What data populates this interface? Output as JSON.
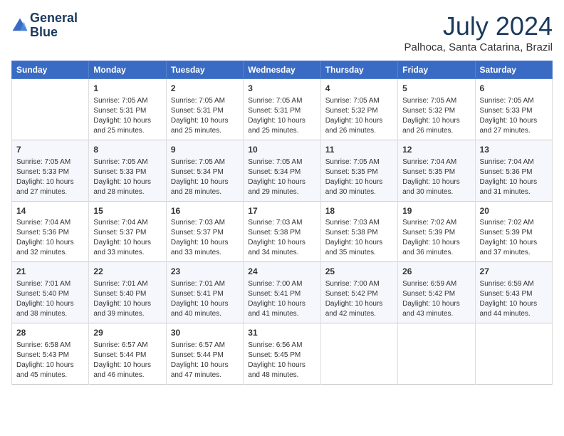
{
  "header": {
    "logo_line1": "General",
    "logo_line2": "Blue",
    "month": "July 2024",
    "location": "Palhoca, Santa Catarina, Brazil"
  },
  "weekdays": [
    "Sunday",
    "Monday",
    "Tuesday",
    "Wednesday",
    "Thursday",
    "Friday",
    "Saturday"
  ],
  "weeks": [
    [
      {
        "day": "",
        "content": ""
      },
      {
        "day": "1",
        "content": "Sunrise: 7:05 AM\nSunset: 5:31 PM\nDaylight: 10 hours\nand 25 minutes."
      },
      {
        "day": "2",
        "content": "Sunrise: 7:05 AM\nSunset: 5:31 PM\nDaylight: 10 hours\nand 25 minutes."
      },
      {
        "day": "3",
        "content": "Sunrise: 7:05 AM\nSunset: 5:31 PM\nDaylight: 10 hours\nand 25 minutes."
      },
      {
        "day": "4",
        "content": "Sunrise: 7:05 AM\nSunset: 5:32 PM\nDaylight: 10 hours\nand 26 minutes."
      },
      {
        "day": "5",
        "content": "Sunrise: 7:05 AM\nSunset: 5:32 PM\nDaylight: 10 hours\nand 26 minutes."
      },
      {
        "day": "6",
        "content": "Sunrise: 7:05 AM\nSunset: 5:33 PM\nDaylight: 10 hours\nand 27 minutes."
      }
    ],
    [
      {
        "day": "7",
        "content": "Sunrise: 7:05 AM\nSunset: 5:33 PM\nDaylight: 10 hours\nand 27 minutes."
      },
      {
        "day": "8",
        "content": "Sunrise: 7:05 AM\nSunset: 5:33 PM\nDaylight: 10 hours\nand 28 minutes."
      },
      {
        "day": "9",
        "content": "Sunrise: 7:05 AM\nSunset: 5:34 PM\nDaylight: 10 hours\nand 28 minutes."
      },
      {
        "day": "10",
        "content": "Sunrise: 7:05 AM\nSunset: 5:34 PM\nDaylight: 10 hours\nand 29 minutes."
      },
      {
        "day": "11",
        "content": "Sunrise: 7:05 AM\nSunset: 5:35 PM\nDaylight: 10 hours\nand 30 minutes."
      },
      {
        "day": "12",
        "content": "Sunrise: 7:04 AM\nSunset: 5:35 PM\nDaylight: 10 hours\nand 30 minutes."
      },
      {
        "day": "13",
        "content": "Sunrise: 7:04 AM\nSunset: 5:36 PM\nDaylight: 10 hours\nand 31 minutes."
      }
    ],
    [
      {
        "day": "14",
        "content": "Sunrise: 7:04 AM\nSunset: 5:36 PM\nDaylight: 10 hours\nand 32 minutes."
      },
      {
        "day": "15",
        "content": "Sunrise: 7:04 AM\nSunset: 5:37 PM\nDaylight: 10 hours\nand 33 minutes."
      },
      {
        "day": "16",
        "content": "Sunrise: 7:03 AM\nSunset: 5:37 PM\nDaylight: 10 hours\nand 33 minutes."
      },
      {
        "day": "17",
        "content": "Sunrise: 7:03 AM\nSunset: 5:38 PM\nDaylight: 10 hours\nand 34 minutes."
      },
      {
        "day": "18",
        "content": "Sunrise: 7:03 AM\nSunset: 5:38 PM\nDaylight: 10 hours\nand 35 minutes."
      },
      {
        "day": "19",
        "content": "Sunrise: 7:02 AM\nSunset: 5:39 PM\nDaylight: 10 hours\nand 36 minutes."
      },
      {
        "day": "20",
        "content": "Sunrise: 7:02 AM\nSunset: 5:39 PM\nDaylight: 10 hours\nand 37 minutes."
      }
    ],
    [
      {
        "day": "21",
        "content": "Sunrise: 7:01 AM\nSunset: 5:40 PM\nDaylight: 10 hours\nand 38 minutes."
      },
      {
        "day": "22",
        "content": "Sunrise: 7:01 AM\nSunset: 5:40 PM\nDaylight: 10 hours\nand 39 minutes."
      },
      {
        "day": "23",
        "content": "Sunrise: 7:01 AM\nSunset: 5:41 PM\nDaylight: 10 hours\nand 40 minutes."
      },
      {
        "day": "24",
        "content": "Sunrise: 7:00 AM\nSunset: 5:41 PM\nDaylight: 10 hours\nand 41 minutes."
      },
      {
        "day": "25",
        "content": "Sunrise: 7:00 AM\nSunset: 5:42 PM\nDaylight: 10 hours\nand 42 minutes."
      },
      {
        "day": "26",
        "content": "Sunrise: 6:59 AM\nSunset: 5:42 PM\nDaylight: 10 hours\nand 43 minutes."
      },
      {
        "day": "27",
        "content": "Sunrise: 6:59 AM\nSunset: 5:43 PM\nDaylight: 10 hours\nand 44 minutes."
      }
    ],
    [
      {
        "day": "28",
        "content": "Sunrise: 6:58 AM\nSunset: 5:43 PM\nDaylight: 10 hours\nand 45 minutes."
      },
      {
        "day": "29",
        "content": "Sunrise: 6:57 AM\nSunset: 5:44 PM\nDaylight: 10 hours\nand 46 minutes."
      },
      {
        "day": "30",
        "content": "Sunrise: 6:57 AM\nSunset: 5:44 PM\nDaylight: 10 hours\nand 47 minutes."
      },
      {
        "day": "31",
        "content": "Sunrise: 6:56 AM\nSunset: 5:45 PM\nDaylight: 10 hours\nand 48 minutes."
      },
      {
        "day": "",
        "content": ""
      },
      {
        "day": "",
        "content": ""
      },
      {
        "day": "",
        "content": ""
      }
    ]
  ]
}
